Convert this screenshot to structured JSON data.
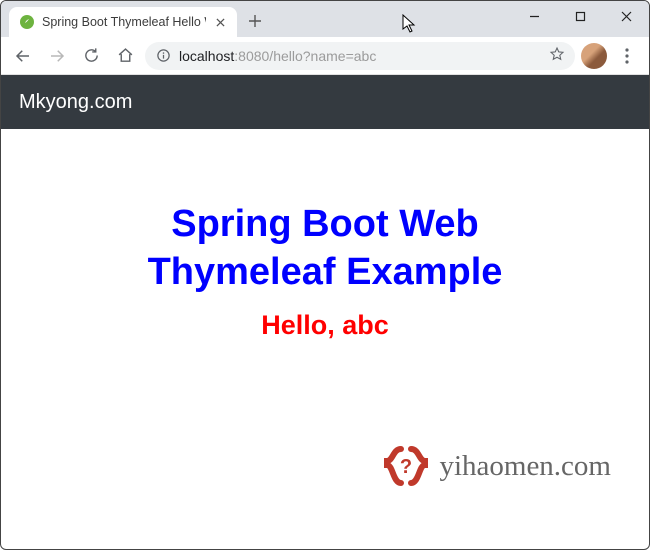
{
  "browser": {
    "tab": {
      "title": "Spring Boot Thymeleaf Hello Wo"
    },
    "address": {
      "host": "localhost",
      "port_path": ":8080/hello?name=abc"
    }
  },
  "page": {
    "brand": "Mkyong.com",
    "title_line1": "Spring Boot Web",
    "title_line2": "Thymeleaf Example",
    "greeting": "Hello, abc"
  },
  "watermark": {
    "text": "yihaomen.com",
    "glyph": "?"
  }
}
